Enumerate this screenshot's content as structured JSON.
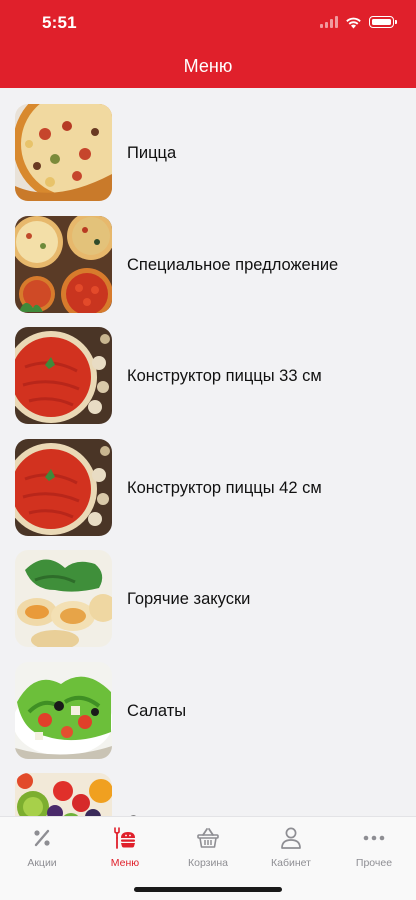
{
  "status": {
    "time": "5:51"
  },
  "header": {
    "title": "Меню"
  },
  "menu": {
    "items": [
      {
        "label": "Пицца",
        "icon": "pizza-image"
      },
      {
        "label": "Специальное предложение",
        "icon": "pizza-assortment-image"
      },
      {
        "label": "Конструктор пиццы 33 см",
        "icon": "pizza-base-image"
      },
      {
        "label": "Конструктор пиццы 42 см",
        "icon": "pizza-base-image"
      },
      {
        "label": "Горячие закуски",
        "icon": "rolls-image"
      },
      {
        "label": "Салаты",
        "icon": "salad-image"
      },
      {
        "label": "С",
        "icon": "fruit-image"
      }
    ]
  },
  "tabs": [
    {
      "label": "Акции",
      "icon": "percent-icon",
      "active": false
    },
    {
      "label": "Меню",
      "icon": "menu-food-icon",
      "active": true
    },
    {
      "label": "Корзина",
      "icon": "basket-icon",
      "active": false
    },
    {
      "label": "Кабинет",
      "icon": "user-icon",
      "active": false
    },
    {
      "label": "Прочее",
      "icon": "more-icon",
      "active": false
    }
  ],
  "colors": {
    "brand": "#e0202b",
    "tab_inactive": "#8e8e93",
    "background": "#f2f2f4"
  }
}
